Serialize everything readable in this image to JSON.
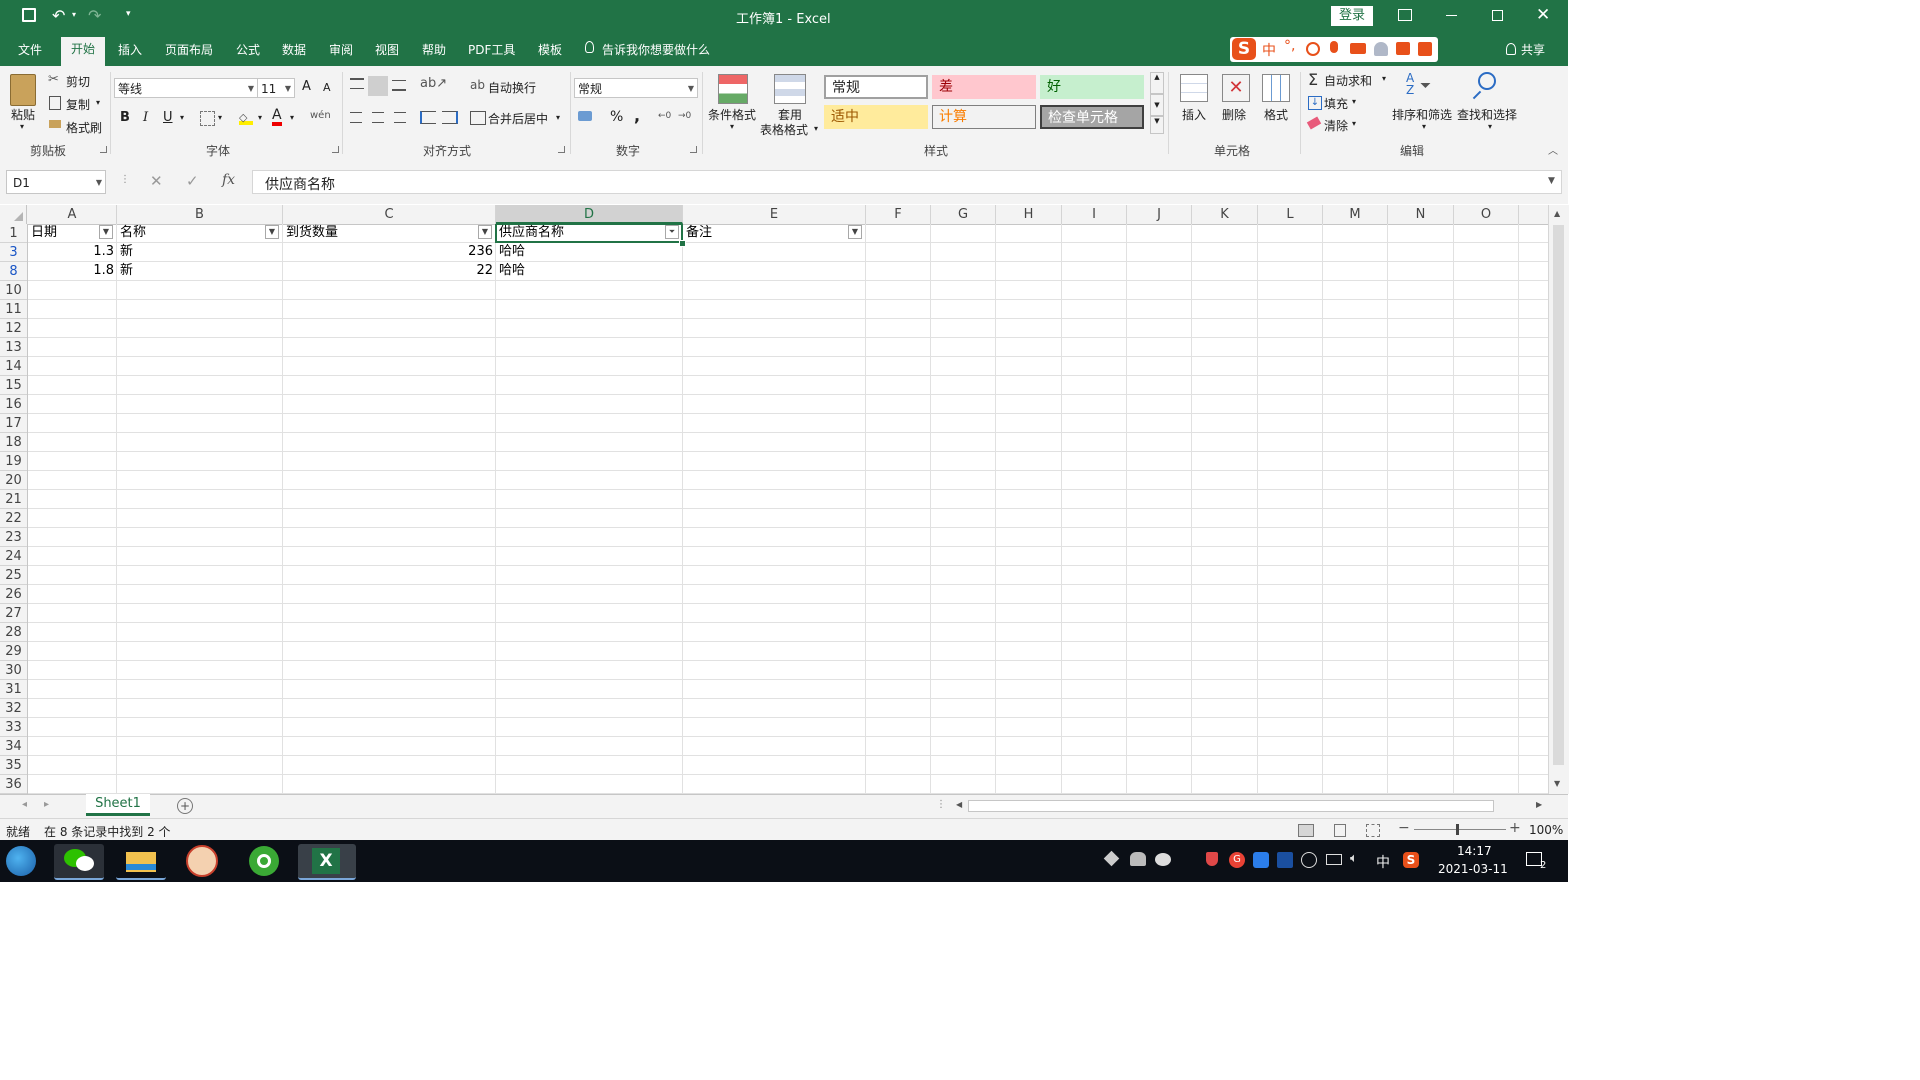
{
  "titlebar": {
    "title": "工作簿1 - Excel",
    "login_label": "登录"
  },
  "tabs": [
    "文件",
    "开始",
    "插入",
    "页面布局",
    "公式",
    "数据",
    "审阅",
    "视图",
    "帮助",
    "PDF工具",
    "模板"
  ],
  "tell_me": "告诉我你想要做什么",
  "share_label": "共享",
  "clipboard": {
    "paste": "粘贴",
    "cut": "剪切",
    "copy": "复制",
    "format_painter": "格式刷",
    "group": "剪贴板"
  },
  "font": {
    "name": "等线",
    "size": "11",
    "bold": "B",
    "italic": "I",
    "underline": "U",
    "grow": "A",
    "shrink": "A",
    "color_glyph": "A",
    "group": "字体"
  },
  "alignment": {
    "wrap": "自动换行",
    "merge": "合并后居中",
    "group": "对齐方式"
  },
  "number": {
    "format": "常规",
    "percent": "%",
    "comma": ",",
    "group": "数字"
  },
  "styles": {
    "conditional": "条件格式",
    "table_format_1": "套用",
    "table_format_2": "表格格式",
    "normal": "常规",
    "bad": "差",
    "good": "好",
    "neutral": "适中",
    "calculation": "计算",
    "check_cell": "检查单元格",
    "group": "样式"
  },
  "cells_group": {
    "insert": "插入",
    "delete": "删除",
    "format": "格式",
    "group": "单元格"
  },
  "editing": {
    "autosum": "自动求和",
    "fill": "填充",
    "clear": "清除",
    "sort_filter": "排序和筛选",
    "find_select": "查找和选择",
    "group": "编辑"
  },
  "formula_bar": {
    "name_box": "D1",
    "fx": "fx",
    "content": "供应商名称"
  },
  "columns": [
    "A",
    "B",
    "C",
    "D",
    "E",
    "F",
    "G",
    "H",
    "I",
    "J",
    "K",
    "L",
    "M",
    "N",
    "O"
  ],
  "rows": [
    "1",
    "3",
    "8",
    "10",
    "11",
    "12",
    "13",
    "14",
    "15",
    "16",
    "17",
    "18",
    "19",
    "20",
    "21",
    "22",
    "23",
    "24",
    "25",
    "26",
    "27",
    "28",
    "29",
    "30",
    "31",
    "32",
    "33",
    "34",
    "35",
    "36"
  ],
  "headers": [
    "日期",
    "名称",
    "到货数量",
    "供应商名称",
    "备注"
  ],
  "data_rows": [
    {
      "date": "1.3",
      "name": "新",
      "qty": "236",
      "supplier": "哈哈"
    },
    {
      "date": "1.8",
      "name": "新",
      "qty": "22",
      "supplier": "哈哈"
    }
  ],
  "sheet_tab": "Sheet1",
  "status": {
    "ready": "就绪",
    "filter_msg": "在 8 条记录中找到 2 个",
    "zoom": "100%"
  },
  "taskbar": {
    "time": "14:17",
    "date": "2021-03-11",
    "ime": "中",
    "notif_count": "2"
  },
  "colors": {
    "excel_green": "#217346",
    "normal_bg": "#ffffff",
    "bad_bg": "#ffc7ce",
    "good_bg": "#c6efce",
    "neutral_bg": "#ffeb9c",
    "calc_bg": "#f2f2f2",
    "check_bg": "#a5a5a5"
  }
}
